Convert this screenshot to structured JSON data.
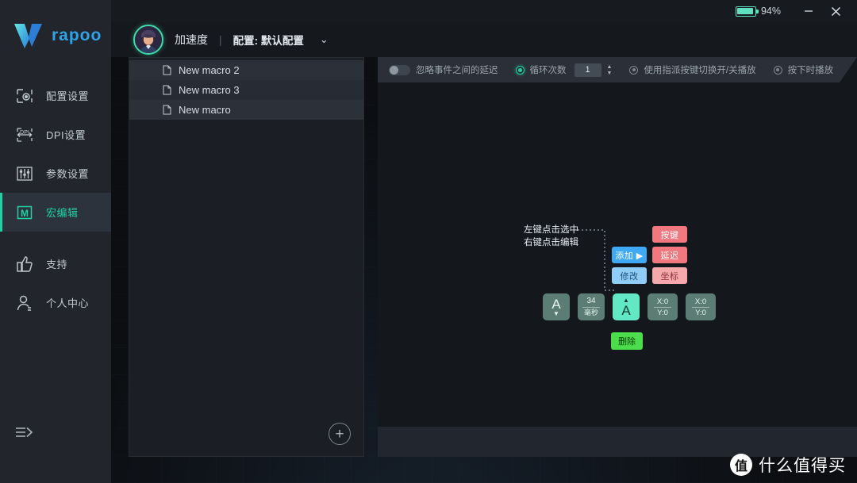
{
  "titlebar": {
    "battery_percent": "94%",
    "battery_level": 94,
    "minimize_label": "–",
    "close_label": "✕"
  },
  "sidebar": {
    "logo_text": "rapoo",
    "items": [
      {
        "label": "配置设置",
        "icon": "config-icon",
        "active": false
      },
      {
        "label": "DPI设置",
        "icon": "dpi-icon",
        "active": false
      },
      {
        "label": "参数设置",
        "icon": "sliders-icon",
        "active": false
      },
      {
        "label": "宏编辑",
        "icon": "macro-icon",
        "active": true
      },
      {
        "label": "支持",
        "icon": "thumbs-up-icon",
        "active": false
      },
      {
        "label": "个人中心",
        "icon": "user-icon",
        "active": false
      }
    ],
    "collapse_icon": "expand-arrow-icon"
  },
  "header": {
    "device_name": "加速度",
    "separator": "|",
    "profile_label": "配置: 默认配置",
    "caret": "⌄"
  },
  "macro_list": {
    "items": [
      {
        "name": "New macro 2"
      },
      {
        "name": "New macro 3"
      },
      {
        "name": "New macro"
      }
    ],
    "add_label": "+"
  },
  "editor": {
    "options": {
      "ignore_delay_label": "忽略事件之间的延迟",
      "ignore_delay_on": false,
      "loop_count_label": "循环次数",
      "loop_count_selected": true,
      "loop_count_value": "1",
      "toggle_play_label": "使用指派按键切换开/关播放",
      "press_play_label": "按下时播放"
    },
    "tooltip": {
      "line1": "左键点击选中",
      "line2": "右键点击编辑"
    },
    "context_menu": {
      "add_label": "添加 ▶",
      "modify_label": "修改",
      "key_label": "按键",
      "delay_label": "延迟",
      "coord_label": "坐标"
    },
    "nodes": [
      {
        "type": "key-up",
        "glyph": "A",
        "arrow": "▼",
        "selected": false
      },
      {
        "type": "delay",
        "value": "34",
        "unit": "毫秒",
        "selected": false
      },
      {
        "type": "key-down",
        "glyph": "A",
        "arrow": "▲",
        "selected": true
      },
      {
        "type": "coord",
        "x": "X:0",
        "y": "Y:0",
        "selected": false
      },
      {
        "type": "coord",
        "x": "X:0",
        "y": "Y:0",
        "selected": false
      }
    ],
    "delete_label": "删除"
  },
  "watermark": {
    "logo_char": "值",
    "text": "什么值得买"
  },
  "colors": {
    "accent": "#1fd3a7",
    "logo_blue": "#2fa3e8",
    "selected_node": "#63e8c6",
    "delete_green": "#4cdd4c",
    "add_blue": "#3fa9f5",
    "key_red": "#f0787e"
  }
}
